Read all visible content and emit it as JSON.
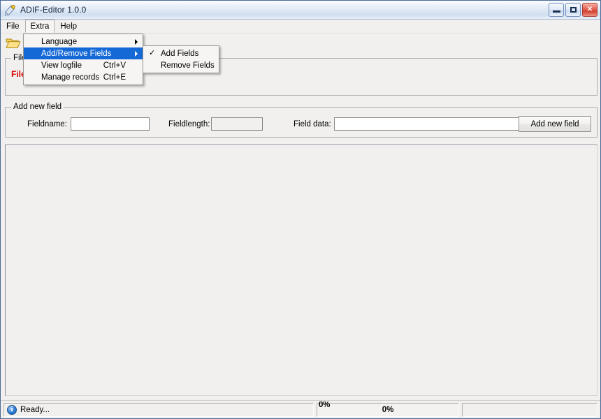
{
  "window": {
    "title": "ADIF-Editor 1.0.0",
    "app_icon": "pencil-document-icon",
    "buttons": {
      "minimize": "minimize-icon",
      "maximize": "maximize-icon",
      "close": "✕"
    }
  },
  "menubar": {
    "items": [
      {
        "label": "File",
        "open": false
      },
      {
        "label": "Extra",
        "open": true
      },
      {
        "label": "Help",
        "open": false
      }
    ]
  },
  "menus": {
    "extra": {
      "items": [
        {
          "label": "Language",
          "shortcut": "",
          "submenu": true,
          "selected": false
        },
        {
          "label": "Add/Remove Fields",
          "shortcut": "",
          "submenu": true,
          "selected": true
        },
        {
          "label": "View logfile",
          "shortcut": "Ctrl+V",
          "submenu": false,
          "selected": false
        },
        {
          "label": "Manage records",
          "shortcut": "Ctrl+E",
          "submenu": false,
          "selected": false
        }
      ]
    },
    "add_remove_fields": {
      "items": [
        {
          "label": "Add Fields",
          "checked": true
        },
        {
          "label": "Remove Fields",
          "checked": false
        }
      ]
    }
  },
  "toolbar": {
    "open_icon": "open-folder-icon"
  },
  "file_group": {
    "title": "File",
    "status_text": "File"
  },
  "add_field_group": {
    "title": "Add new field",
    "fieldname_label": "Fieldname:",
    "fieldname_value": "",
    "fieldname_placeholder": "",
    "fieldlength_label": "Fieldlength:",
    "fieldlength_value": "",
    "fieldlength_placeholder": "",
    "fielddata_label": "Field data:",
    "fielddata_value": "",
    "fielddata_placeholder": "",
    "add_button_label": "Add new field"
  },
  "statusbar": {
    "icon": "info-icon",
    "message": "Ready...",
    "progress_percent": "0%",
    "progress_clip_label": "0%",
    "right_panel_text": ""
  },
  "colors": {
    "menu_highlight": "#1569d6",
    "status_red": "#d90000",
    "title_border": "#4a6a96"
  }
}
